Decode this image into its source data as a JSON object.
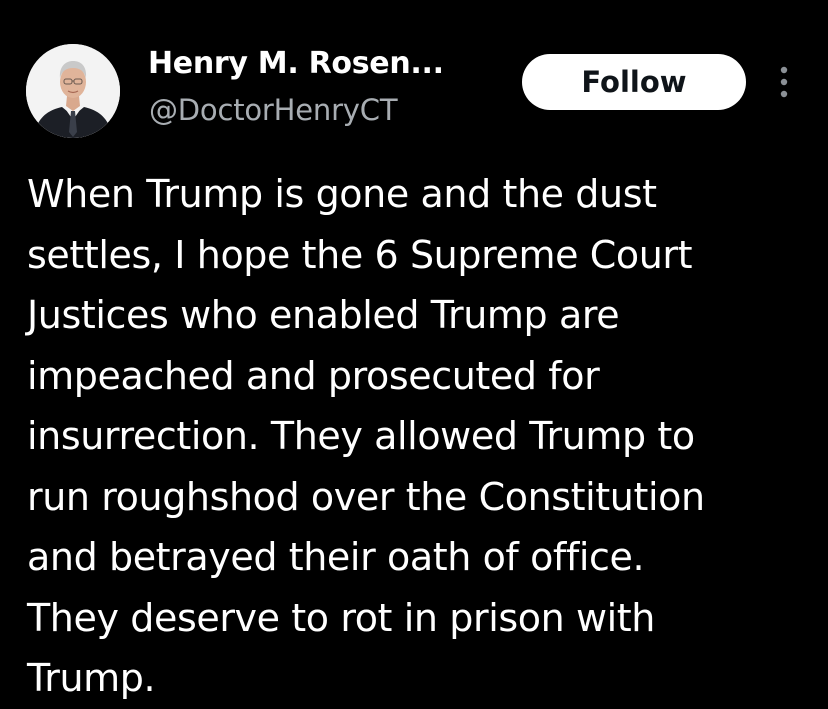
{
  "author": {
    "display_name": "Henry M. Rosen...",
    "handle": "@DoctorHenryCT",
    "avatar_icon": "user-avatar-photo"
  },
  "actions": {
    "follow_label": "Follow",
    "more_icon": "more-vertical-icon"
  },
  "tweet": {
    "text_lines": [
      "When Trump is gone and the dust",
      "settles, I hope the 6 Supreme Court",
      "Justices who enabled Trump are",
      "impeached and prosecuted for",
      "insurrection. They allowed Trump to",
      "run roughshod over the Constitution",
      "and betrayed their oath of office.",
      "They deserve to rot in prison with",
      "Trump."
    ]
  },
  "colors": {
    "background": "#000000",
    "text_primary": "#ffffff",
    "text_secondary": "#a8adb2",
    "button_bg": "#ffffff",
    "button_text": "#0f1419"
  }
}
